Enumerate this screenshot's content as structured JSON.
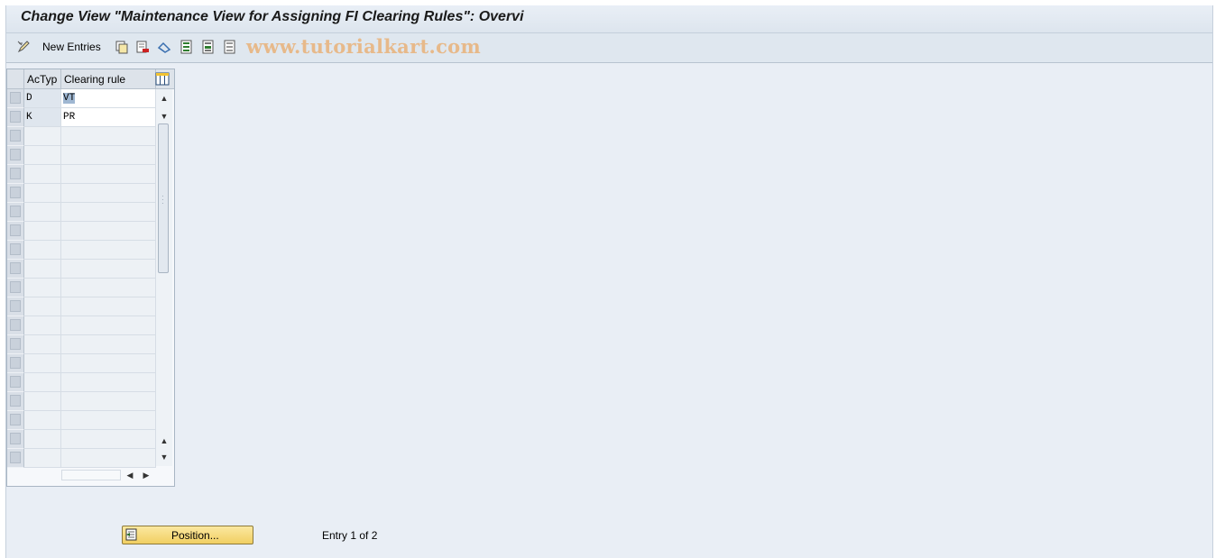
{
  "window": {
    "title": "Change View \"Maintenance View for Assigning FI Clearing Rules\": Overvi"
  },
  "toolbar": {
    "new_entries_label": "New Entries",
    "icons": [
      "edit-toggle-icon",
      "copy-icon",
      "delete-icon",
      "undo-change-icon",
      "select-all-icon",
      "select-block-icon",
      "deselect-all-icon"
    ],
    "watermark": "www.tutorialkart.com"
  },
  "table": {
    "columns": [
      "AcTyp",
      "Clearing rule"
    ],
    "rows": [
      {
        "actyp": "D",
        "rule": "VT"
      },
      {
        "actyp": "K",
        "rule": "PR"
      }
    ],
    "empty_rows": 18
  },
  "footer": {
    "position_label": "Position...",
    "entry_status": "Entry 1 of 2"
  },
  "colors": {
    "background": "#e9eef5",
    "button_yellow": "#f1cf62",
    "watermark": "#e7b98a",
    "selection": "#9fb7d2"
  }
}
